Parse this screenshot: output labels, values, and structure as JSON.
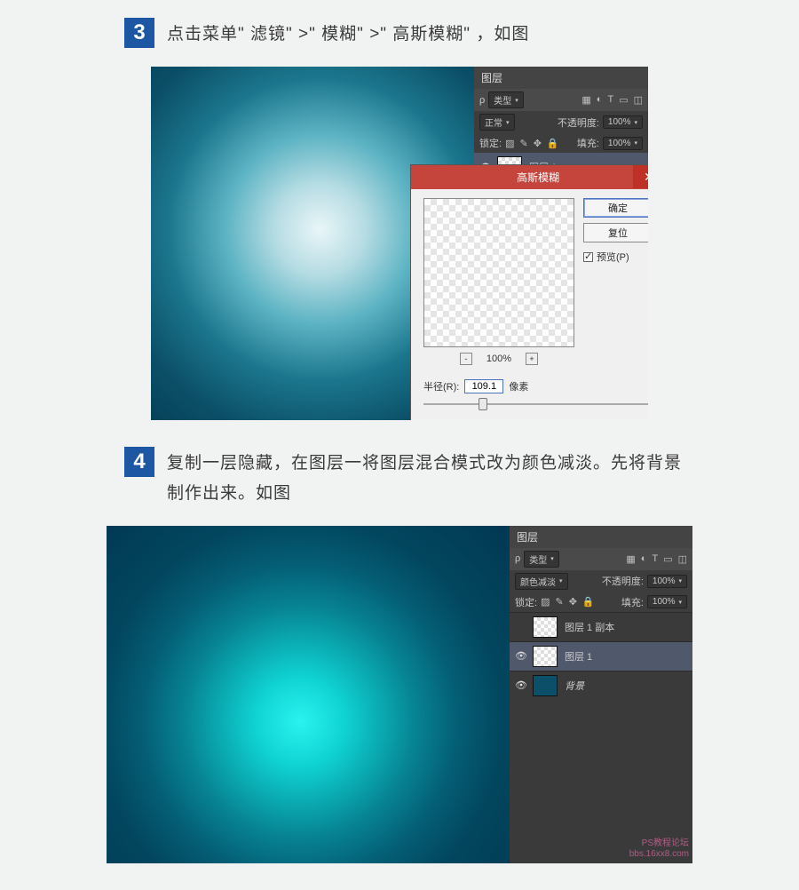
{
  "step3": {
    "number": "3",
    "text": "点击菜单\" 滤镜\" >\" 模糊\" >\" 高斯模糊\" ，如图",
    "layers_panel": {
      "title": "图层",
      "filter_label": "类型",
      "blend_mode": "正常",
      "opacity_label": "不透明度:",
      "opacity_value": "100%",
      "lock_label": "锁定:",
      "fill_label": "填充:",
      "fill_value": "100%",
      "layers": [
        {
          "name": "图层 1"
        }
      ]
    },
    "dialog": {
      "title": "高斯模糊",
      "ok": "确定",
      "reset": "复位",
      "preview_label": "预览(P)",
      "zoom": "100%",
      "radius_label": "半径(R):",
      "radius_value": "109.1",
      "radius_unit": "像素"
    }
  },
  "step4": {
    "number": "4",
    "text": "复制一层隐藏，在图层一将图层混合模式改为颜色减淡。先将背景制作出来。如图",
    "layers_panel": {
      "title": "图层",
      "filter_label": "类型",
      "blend_mode": "颜色减淡",
      "opacity_label": "不透明度:",
      "opacity_value": "100%",
      "lock_label": "锁定:",
      "fill_label": "填充:",
      "fill_value": "100%",
      "layers": [
        {
          "name": "图层 1 副本"
        },
        {
          "name": "图层 1"
        },
        {
          "name": "背景"
        }
      ]
    },
    "watermark": {
      "line1": "PS教程论坛",
      "line2": "bbs.16xx8.com"
    }
  }
}
